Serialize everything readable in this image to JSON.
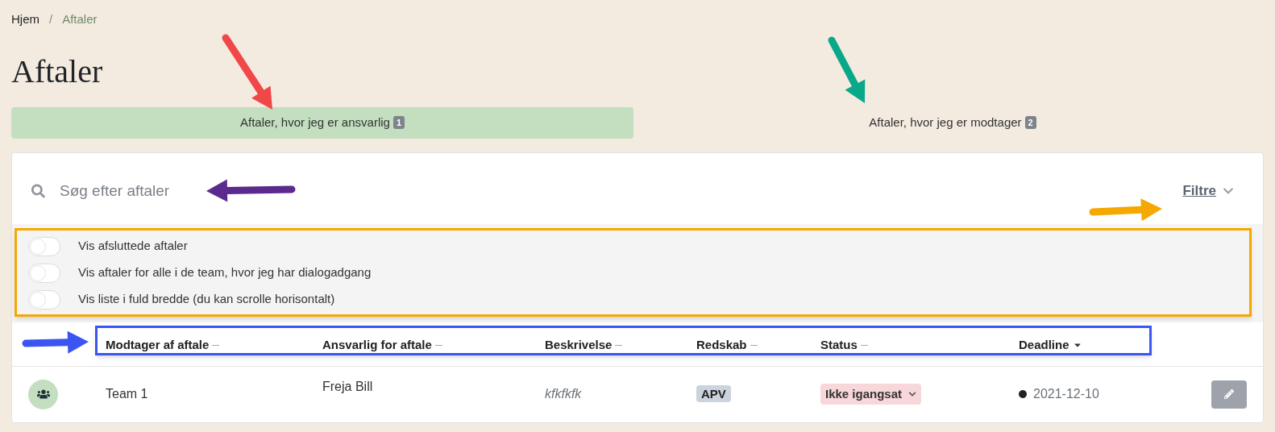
{
  "breadcrumb": {
    "separator": "/",
    "items": [
      {
        "label": "Hjem",
        "current": false
      },
      {
        "label": "Aftaler",
        "current": true
      }
    ]
  },
  "title": "Aftaler",
  "tabs": [
    {
      "label": "Aftaler, hvor jeg er ansvarlig",
      "count": "1",
      "selected": true
    },
    {
      "label": "Aftaler, hvor jeg er modtager",
      "count": "2",
      "selected": false
    }
  ],
  "search": {
    "placeholder": "Søg efter aftaler"
  },
  "filters_link": "Filtre",
  "toggles": [
    {
      "label": "Vis afsluttede aftaler",
      "on": false
    },
    {
      "label": "Vis aftaler for alle i de team, hvor jeg har dialogadgang",
      "on": false
    },
    {
      "label": "Vis liste i fuld bredde (du kan scrolle horisontalt)",
      "on": false
    }
  ],
  "table": {
    "columns": [
      {
        "label": "Modtager af aftale",
        "sorted": false
      },
      {
        "label": "Ansvarlig for aftale",
        "sorted": false
      },
      {
        "label": "Beskrivelse",
        "sorted": false
      },
      {
        "label": "Redskab",
        "sorted": false
      },
      {
        "label": "Status",
        "sorted": false
      },
      {
        "label": "Deadline",
        "sorted": true
      }
    ],
    "rows": [
      {
        "recipient": "Team 1",
        "responsible": "Freja Bill",
        "description": "kfkfkfk",
        "tool": "APV",
        "status": "Ikke igangsat",
        "deadline": "2021-12-10"
      }
    ]
  }
}
